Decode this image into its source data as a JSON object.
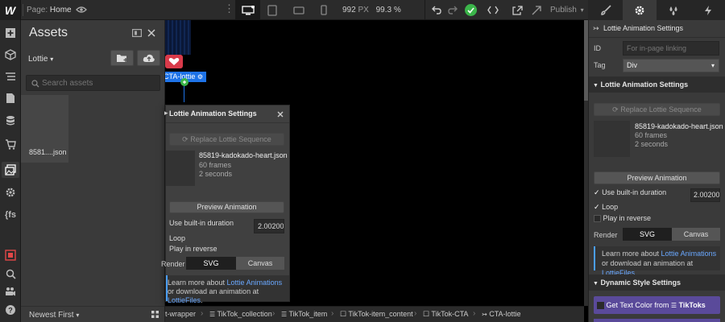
{
  "topbar": {
    "page_prefix": "Page:",
    "page_name": "Home",
    "width_value": "992",
    "width_unit": "PX",
    "zoom": "99.3 %",
    "publish_label": "Publish"
  },
  "assets": {
    "title": "Assets",
    "folder": "Lottie",
    "search_placeholder": "Search assets",
    "item_label": "8581....json",
    "sort_label": "Newest First"
  },
  "canvas": {
    "element_tag": "CTA-lottie"
  },
  "popup": {
    "title": "Lottie Animation Settings",
    "replace_label": "Replace Lottie Sequence",
    "file_name": "85819-kadokado-heart.json",
    "frames": "60 frames",
    "duration": "2 seconds",
    "preview_label": "Preview Animation",
    "builtin_label": "Use built-in duration",
    "duration_value": "2.00200",
    "loop_label": "Loop",
    "reverse_label": "Play in reverse",
    "render_label": "Render",
    "render_svg": "SVG",
    "render_canvas": "Canvas",
    "info_prefix": "Learn more about ",
    "info_link1": "Lottie Animations",
    "info_mid": " or download an animation at ",
    "info_link2": "LottieFiles",
    "info_end": "."
  },
  "breadcrumb": {
    "items": [
      "t-wrapper",
      "TikTok_collection",
      "TikTok_item",
      "TikTok-item_content",
      "TikTok-CTA",
      "CTA-lottie"
    ]
  },
  "right_panel": {
    "header": "Lottie Animation Settings",
    "id_label": "ID",
    "id_placeholder": "For in-page linking",
    "tag_label": "Tag",
    "tag_value": "Div",
    "section_title": "Lottie Animation Settings",
    "replace_label": "Replace Lottie Sequence",
    "file_name": "85819-kadokado-heart.json",
    "frames": "60 frames",
    "duration": "2 seconds",
    "preview_label": "Preview Animation",
    "builtin_label": "Use built-in duration",
    "duration_value": "2.00200",
    "loop_label": "Loop",
    "reverse_label": "Play in reverse",
    "render_label": "Render",
    "render_svg": "SVG",
    "render_canvas": "Canvas",
    "info_prefix": "Learn more about ",
    "info_link1": "Lottie Animations",
    "info_mid": " or download an animation at ",
    "info_link2": "LottieFiles",
    "info_end": ".",
    "dynamic_title": "Dynamic Style Settings",
    "dynamic_item_prefix": "Get Text Color from",
    "dynamic_item_source": "TikToks"
  },
  "colors": {
    "accent": "#4a9eff",
    "success": "#3bb54a",
    "selection": "#1e73e8",
    "dynamic_purple": "#5a4a9a"
  }
}
